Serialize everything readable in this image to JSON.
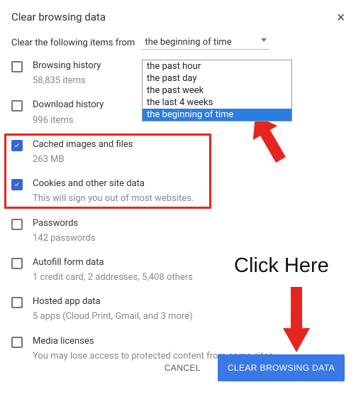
{
  "header": {
    "title": "Clear browsing data",
    "close": "×"
  },
  "from": {
    "label": "Clear the following items from",
    "selected": "the beginning of time",
    "options": [
      "the past hour",
      "the past day",
      "the past week",
      "the last 4 weeks",
      "the beginning of time"
    ]
  },
  "items": [
    {
      "checked": false,
      "label": "Browsing history",
      "sub": "58,835 items"
    },
    {
      "checked": false,
      "label": "Download history",
      "sub": "996 items"
    },
    {
      "checked": true,
      "label": "Cached images and files",
      "sub": "263 MB"
    },
    {
      "checked": true,
      "label": "Cookies and other site data",
      "sub": "This will sign you out of most websites."
    },
    {
      "checked": false,
      "label": "Passwords",
      "sub": "142 passwords"
    },
    {
      "checked": false,
      "label": "Autofill form data",
      "sub": "1 credit card, 2 addresses, 5,408 others"
    },
    {
      "checked": false,
      "label": "Hosted app data",
      "sub": "5 apps (Cloud Print, Gmail, and 3 more)"
    },
    {
      "checked": false,
      "label": "Media licenses",
      "sub": "You may lose access to protected content from some sites."
    }
  ],
  "annotations": {
    "click_here": "Click Here"
  },
  "buttons": {
    "cancel": "CANCEL",
    "clear": "CLEAR BROWSING DATA"
  }
}
